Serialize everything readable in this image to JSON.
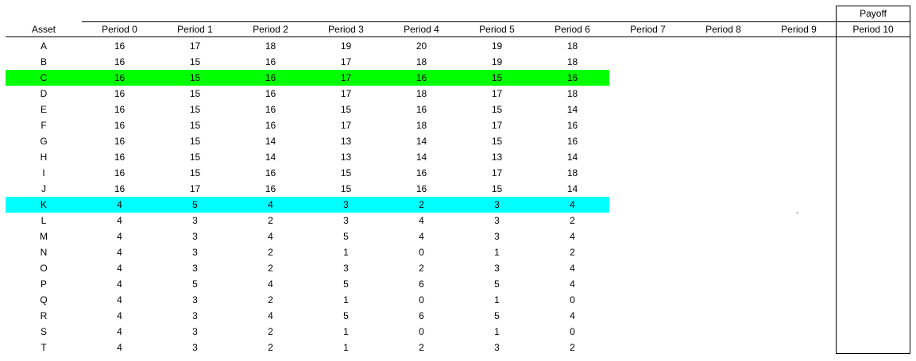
{
  "table": {
    "asset_header": "Asset",
    "payoff_label": "Payoff",
    "period_headers": [
      "Period 0",
      "Period 1",
      "Period 2",
      "Period 3",
      "Period 4",
      "Period 5",
      "Period 6",
      "Period 7",
      "Period 8",
      "Period 9"
    ],
    "payoff_period_header": "Period 10",
    "highlight_colors": {
      "green": "#00ff00",
      "cyan": "#00ffff"
    },
    "rows": [
      {
        "asset": "A",
        "values": [
          "16",
          "17",
          "18",
          "19",
          "20",
          "19",
          "18"
        ],
        "highlight": ""
      },
      {
        "asset": "B",
        "values": [
          "16",
          "15",
          "16",
          "17",
          "18",
          "19",
          "18"
        ],
        "highlight": ""
      },
      {
        "asset": "C",
        "values": [
          "16",
          "15",
          "16",
          "17",
          "16",
          "15",
          "16"
        ],
        "highlight": "green"
      },
      {
        "asset": "D",
        "values": [
          "16",
          "15",
          "16",
          "17",
          "18",
          "17",
          "18"
        ],
        "highlight": ""
      },
      {
        "asset": "E",
        "values": [
          "16",
          "15",
          "16",
          "15",
          "16",
          "15",
          "14"
        ],
        "highlight": ""
      },
      {
        "asset": "F",
        "values": [
          "16",
          "15",
          "16",
          "17",
          "18",
          "17",
          "16"
        ],
        "highlight": ""
      },
      {
        "asset": "G",
        "values": [
          "16",
          "15",
          "14",
          "13",
          "14",
          "15",
          "16"
        ],
        "highlight": ""
      },
      {
        "asset": "H",
        "values": [
          "16",
          "15",
          "14",
          "13",
          "14",
          "13",
          "14"
        ],
        "highlight": ""
      },
      {
        "asset": "I",
        "values": [
          "16",
          "15",
          "16",
          "15",
          "16",
          "17",
          "18"
        ],
        "highlight": ""
      },
      {
        "asset": "J",
        "values": [
          "16",
          "17",
          "16",
          "15",
          "16",
          "15",
          "14"
        ],
        "highlight": ""
      },
      {
        "asset": "K",
        "values": [
          "4",
          "5",
          "4",
          "3",
          "2",
          "3",
          "4"
        ],
        "highlight": "cyan"
      },
      {
        "asset": "L",
        "values": [
          "4",
          "3",
          "2",
          "3",
          "4",
          "3",
          "2"
        ],
        "highlight": ""
      },
      {
        "asset": "M",
        "values": [
          "4",
          "3",
          "4",
          "5",
          "4",
          "3",
          "4"
        ],
        "highlight": ""
      },
      {
        "asset": "N",
        "values": [
          "4",
          "3",
          "2",
          "1",
          "0",
          "1",
          "2"
        ],
        "highlight": ""
      },
      {
        "asset": "O",
        "values": [
          "4",
          "3",
          "2",
          "3",
          "2",
          "3",
          "4"
        ],
        "highlight": ""
      },
      {
        "asset": "P",
        "values": [
          "4",
          "5",
          "4",
          "5",
          "6",
          "5",
          "4"
        ],
        "highlight": ""
      },
      {
        "asset": "Q",
        "values": [
          "4",
          "3",
          "2",
          "1",
          "0",
          "1",
          "0"
        ],
        "highlight": ""
      },
      {
        "asset": "R",
        "values": [
          "4",
          "3",
          "4",
          "5",
          "6",
          "5",
          "4"
        ],
        "highlight": ""
      },
      {
        "asset": "S",
        "values": [
          "4",
          "3",
          "2",
          "1",
          "0",
          "1",
          "0"
        ],
        "highlight": ""
      },
      {
        "asset": "T",
        "values": [
          "4",
          "3",
          "2",
          "1",
          "2",
          "3",
          "2"
        ],
        "highlight": ""
      }
    ],
    "stray_mark": "`"
  }
}
